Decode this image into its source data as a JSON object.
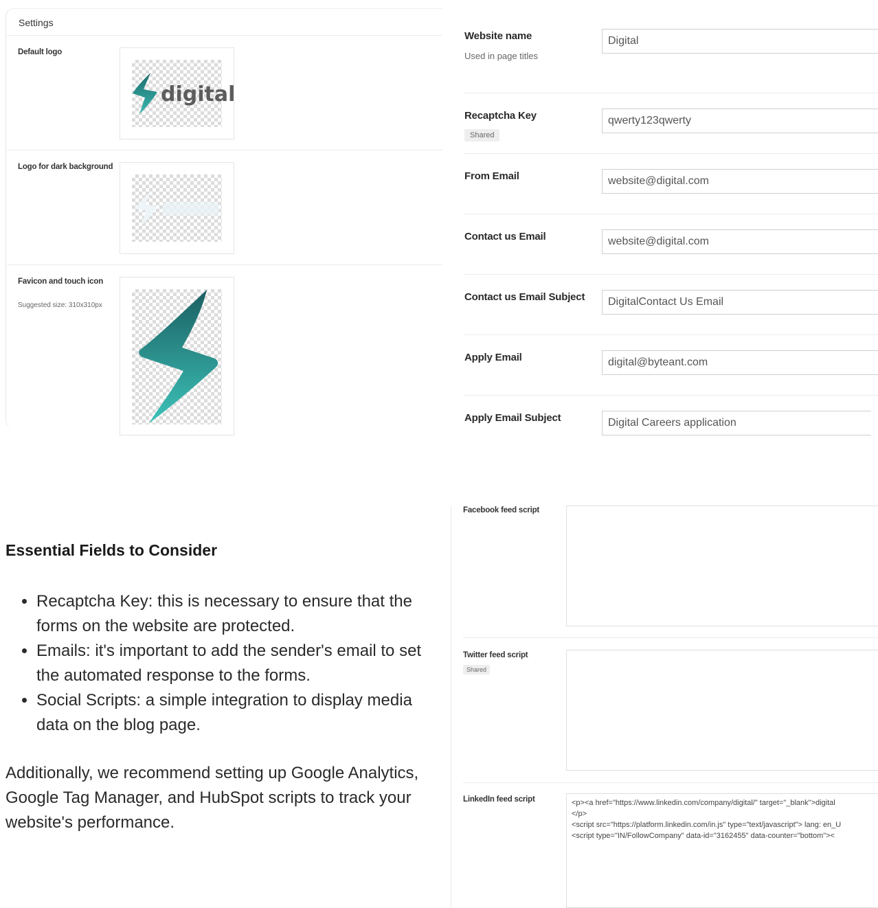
{
  "settings_panel": {
    "title": "Settings",
    "rows": [
      {
        "label": "Default logo",
        "logo_text": "digital"
      },
      {
        "label": "Logo for dark background"
      },
      {
        "label": "Favicon and touch icon",
        "note": "Suggested size: 310x310px"
      }
    ],
    "brand_colors": {
      "teal_dark": "#1f6b6b",
      "teal_light": "#38b8b0"
    }
  },
  "form": {
    "fields": [
      {
        "label": "Website name",
        "note": "Used in page titles",
        "value": "Digital"
      },
      {
        "label": "Recaptcha Key",
        "badge": "Shared",
        "value": "qwerty123qwerty"
      },
      {
        "label": "From Email",
        "value": "website@digital.com"
      },
      {
        "label": "Contact us Email",
        "value": "website@digital.com"
      },
      {
        "label": "Contact us Email Subject",
        "value": "DigitalContact Us Email"
      },
      {
        "label": "Apply Email",
        "value": "digital@byteant.com"
      },
      {
        "label": "Apply Email Subject",
        "value": "Digital Careers application"
      }
    ]
  },
  "article": {
    "heading": "Essential Fields to Consider",
    "bullets": [
      "Recaptcha Key: this is necessary to ensure that the forms on the website are protected.",
      "Emails: it's important to add the sender's email to set the automated response to the forms.",
      "Social Scripts: a simple integration to display media data on the blog page."
    ],
    "paragraph": "Additionally, we recommend setting up Google Analytics, Google Tag Manager, and HubSpot scripts to track your website's performance."
  },
  "social": {
    "facebook_label": "Facebook feed script",
    "twitter_label": "Twitter feed script",
    "twitter_badge": "Shared",
    "linkedin_label": "LinkedIn feed script",
    "linkedin_code": "<p><a href=\"https://www.linkedin.com/company/digital/\" target=\"_blank\">digital\n</p>\n<script src=\"https://platform.linkedin.com/in.js\" type=\"text/javascript\"> lang: en_U\n<script type=\"IN/FollowCompany\" data-id=\"3162455\" data-counter=\"bottom\"><"
  }
}
